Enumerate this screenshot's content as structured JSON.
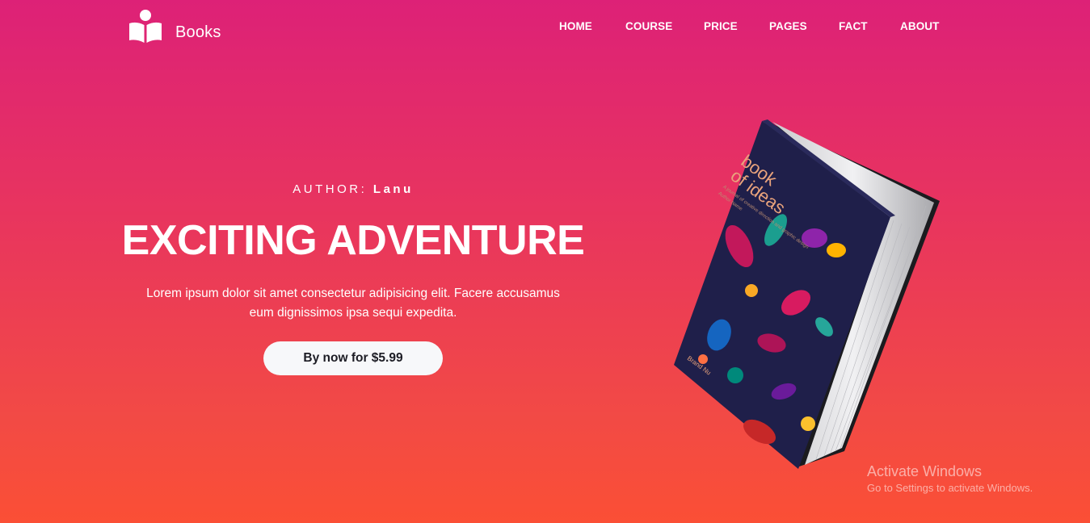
{
  "header": {
    "brand": "Books",
    "logo_icon": "book-reader-icon",
    "nav": [
      {
        "id": "home",
        "label": "HOME"
      },
      {
        "id": "course",
        "label": "COURSE"
      },
      {
        "id": "price",
        "label": "PRICE"
      },
      {
        "id": "pages",
        "label": "PAGES"
      },
      {
        "id": "fact",
        "label": "FACT"
      },
      {
        "id": "about",
        "label": "ABOUT"
      }
    ]
  },
  "hero": {
    "author_label": "AUTHOR:",
    "author_name": "Lanu",
    "title": "EXCITING ADVENTURE",
    "description_line1": "Lorem ipsum dolor sit amet consectetur adipisicing elit. Facere accusamus",
    "description_line2": "eum dignissimos ipsa sequi expedita.",
    "cta_label": "By now for $5.99"
  },
  "book_cover": {
    "title_line1": "book",
    "title_line2": "of ideas",
    "subtitle": "A journal of creative direction and graphic design",
    "author": "Author Name",
    "publisher": "Brand Nu"
  },
  "watermark": {
    "title": "Activate Windows",
    "subtitle": "Go to Settings to activate Windows."
  },
  "colors": {
    "gradient_top": "#dd2177",
    "gradient_bottom": "#fb4f35",
    "button_bg": "#f7f8fa",
    "button_text": "#1c1c24",
    "cover_bg": "#1f1f4a"
  }
}
